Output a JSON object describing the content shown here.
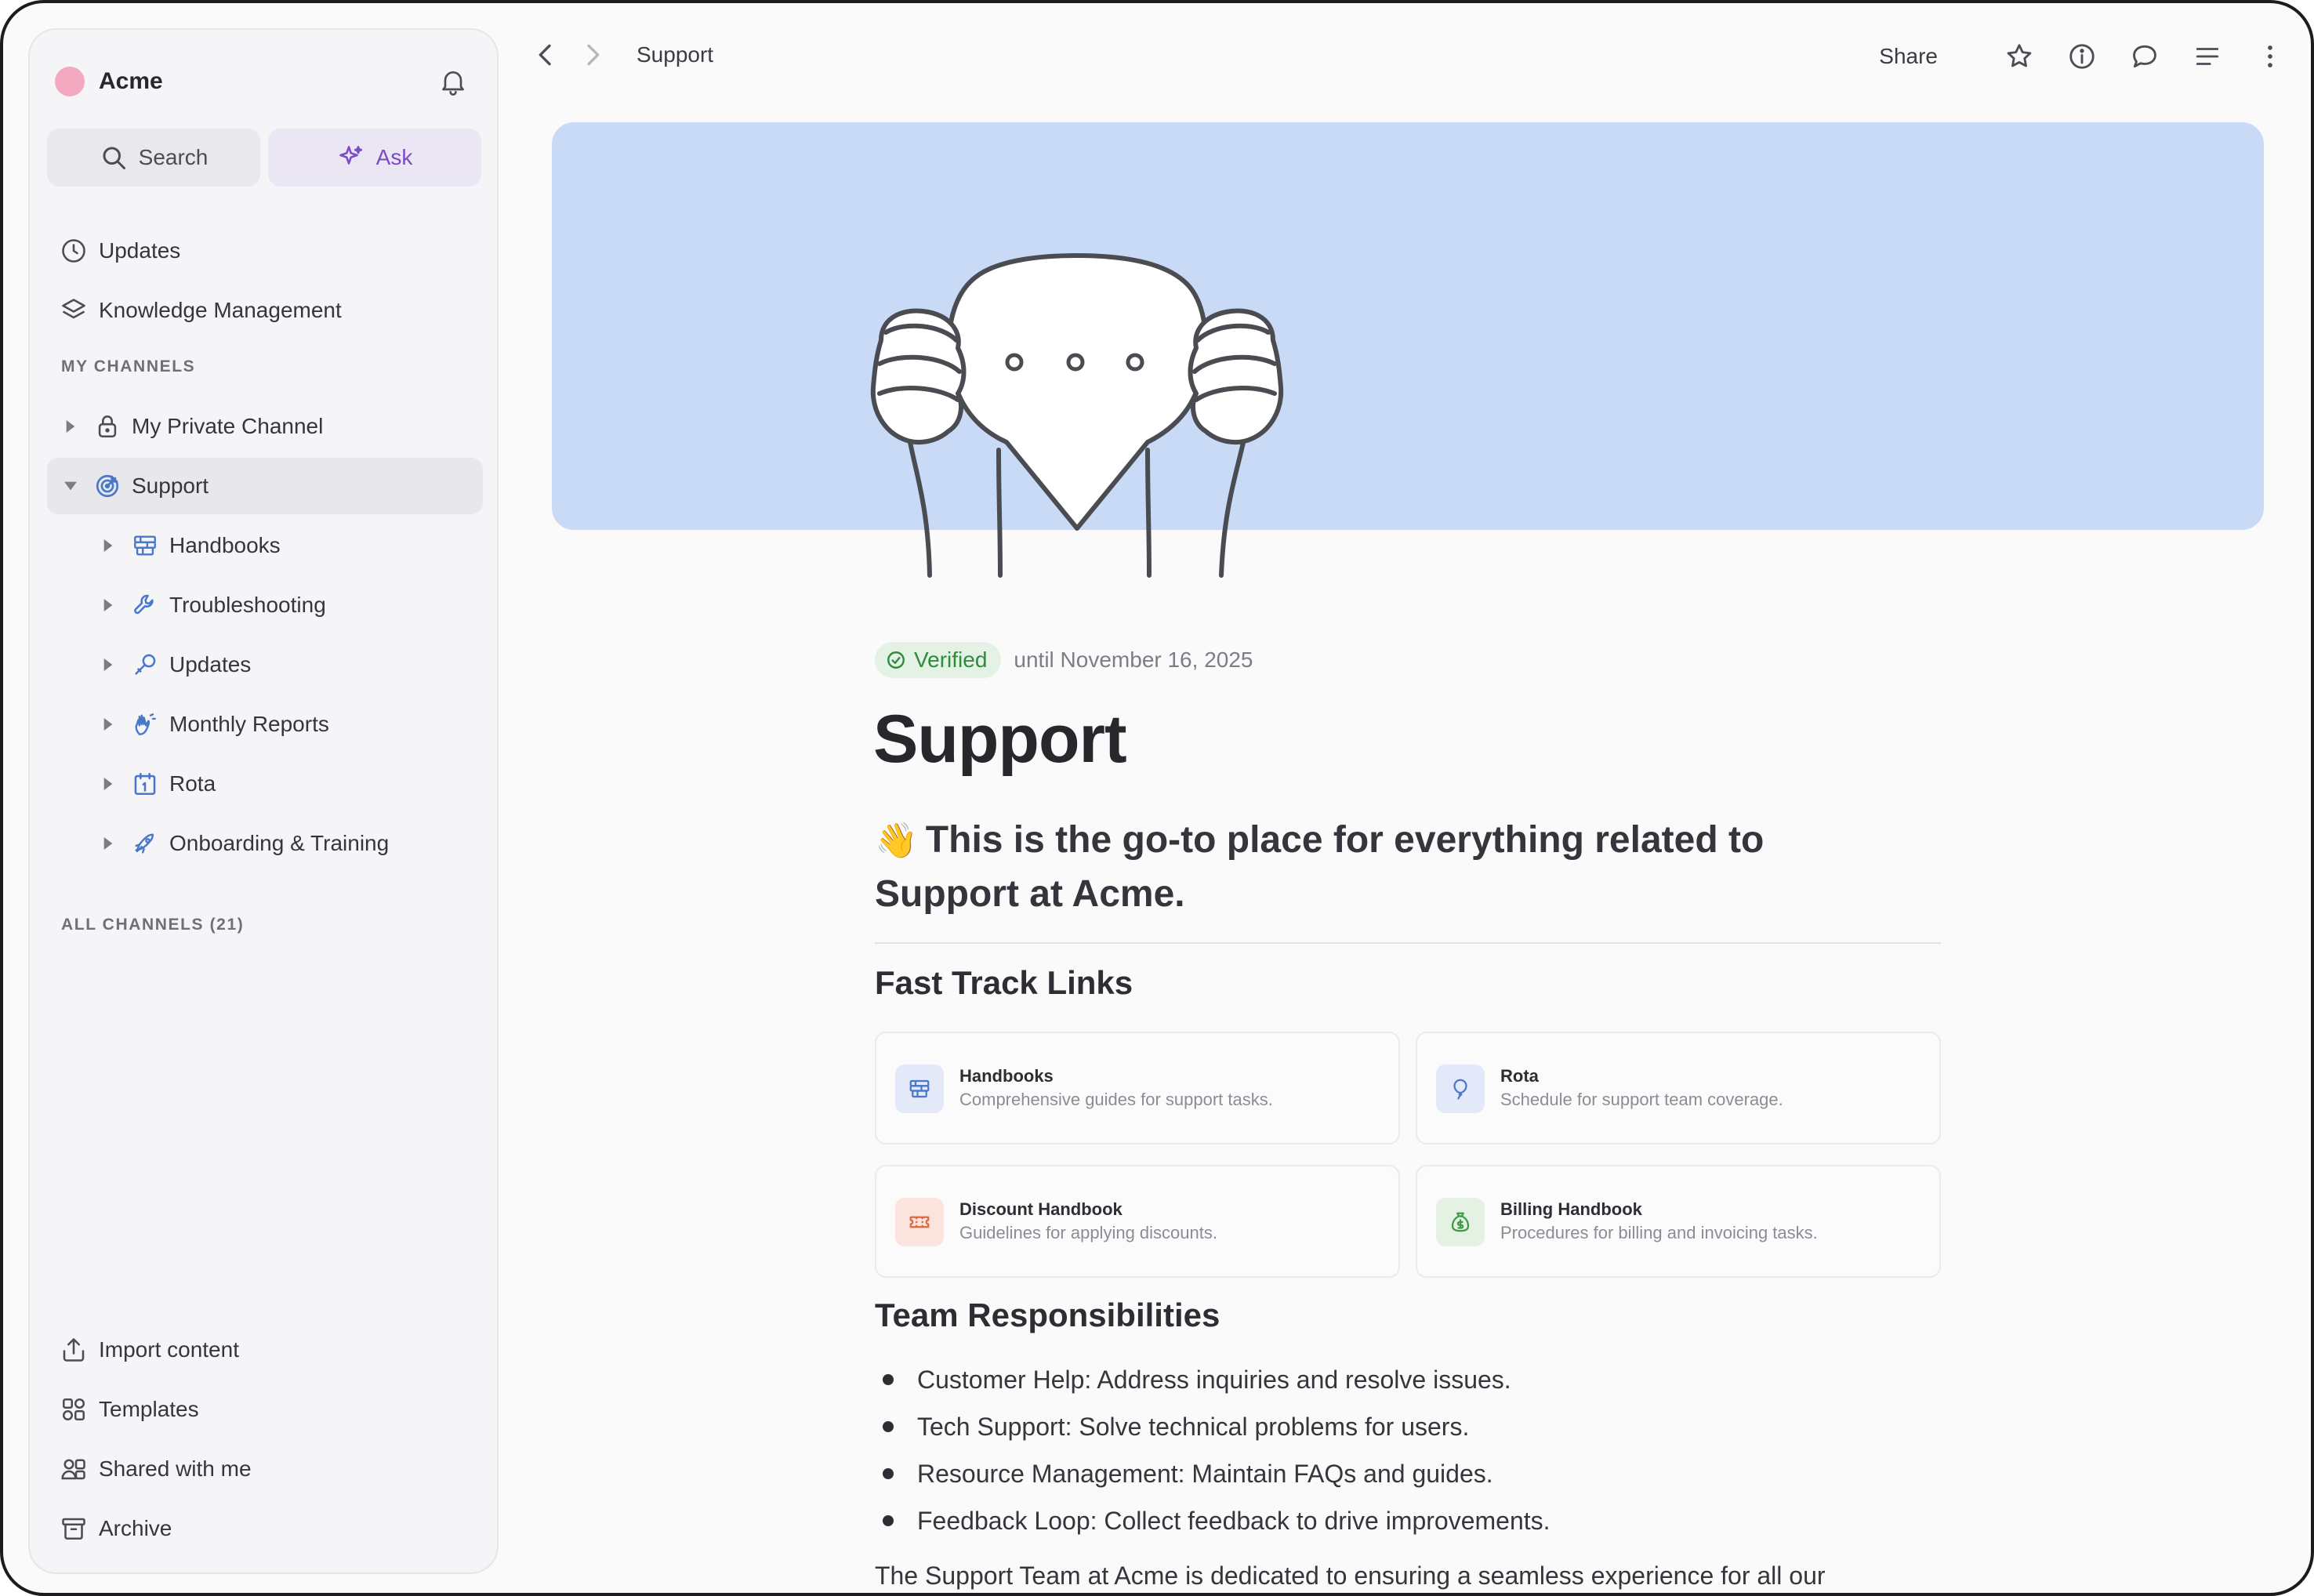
{
  "workspace": {
    "name": "Acme",
    "dot_color": "#f2a8bf"
  },
  "sidebar": {
    "search_label": "Search",
    "ask_label": "Ask",
    "top_items": [
      {
        "label": "Updates",
        "icon": "clock-icon"
      },
      {
        "label": "Knowledge Management",
        "icon": "layers-icon"
      }
    ],
    "my_channels_label": "MY CHANNELS",
    "channels": [
      {
        "label": "My Private Channel",
        "icon": "lock-icon",
        "expanded": false
      },
      {
        "label": "Support",
        "icon": "target-icon",
        "expanded": true,
        "selected": true,
        "children": [
          {
            "label": "Handbooks",
            "icon": "books-icon"
          },
          {
            "label": "Troubleshooting",
            "icon": "wrench-icon"
          },
          {
            "label": "Updates",
            "icon": "microphone-icon"
          },
          {
            "label": "Monthly Reports",
            "icon": "hands-icon"
          },
          {
            "label": "Rota",
            "icon": "calendar-icon"
          },
          {
            "label": "Onboarding & Training",
            "icon": "rocket-icon"
          }
        ]
      }
    ],
    "all_channels_label": "ALL CHANNELS (21)",
    "bottom_items": [
      {
        "label": "Import content",
        "icon": "upload-icon"
      },
      {
        "label": "Templates",
        "icon": "templates-icon"
      },
      {
        "label": "Shared with me",
        "icon": "users-icon"
      },
      {
        "label": "Archive",
        "icon": "archive-icon"
      }
    ]
  },
  "topbar": {
    "breadcrumb": "Support",
    "share_label": "Share"
  },
  "page": {
    "verified_label": "Verified",
    "verified_until": "until November 16, 2025",
    "title": "Support",
    "lead_emoji": "👋",
    "lead_text": "This is the go-to place for everything related to Support at Acme.",
    "fast_track_heading": "Fast Track Links",
    "cards": [
      {
        "title": "Handbooks",
        "desc": "Comprehensive guides for support tasks.",
        "icon": "books-icon",
        "bg": "#e3e9f8",
        "color": "#4a78c9"
      },
      {
        "title": "Rota",
        "desc": "Schedule for support team coverage.",
        "icon": "balloon-icon",
        "bg": "#e3e9f8",
        "color": "#4a78c9"
      },
      {
        "title": "Discount Handbook",
        "desc": "Guidelines for applying discounts.",
        "icon": "ticket-icon",
        "bg": "#fbe3de",
        "color": "#e0663f"
      },
      {
        "title": "Billing Handbook",
        "desc": "Procedures for billing and invoicing tasks.",
        "icon": "moneybag-icon",
        "bg": "#e3f2e3",
        "color": "#3f9a48"
      }
    ],
    "team_heading": "Team Responsibilities",
    "responsibilities": [
      "Customer Help: Address inquiries and resolve issues.",
      "Tech Support: Solve technical problems for users.",
      "Resource Management: Maintain FAQs and guides.",
      "Feedback Loop: Collect feedback to drive improvements."
    ],
    "paragraph": "The Support Team at Acme is dedicated to ensuring a seamless experience for all our"
  },
  "colors": {
    "cover": "#c9daf7",
    "accent_ask": "#7b4bc2",
    "verified": "#2f8a3e",
    "icon_blue": "#4a78c9"
  }
}
